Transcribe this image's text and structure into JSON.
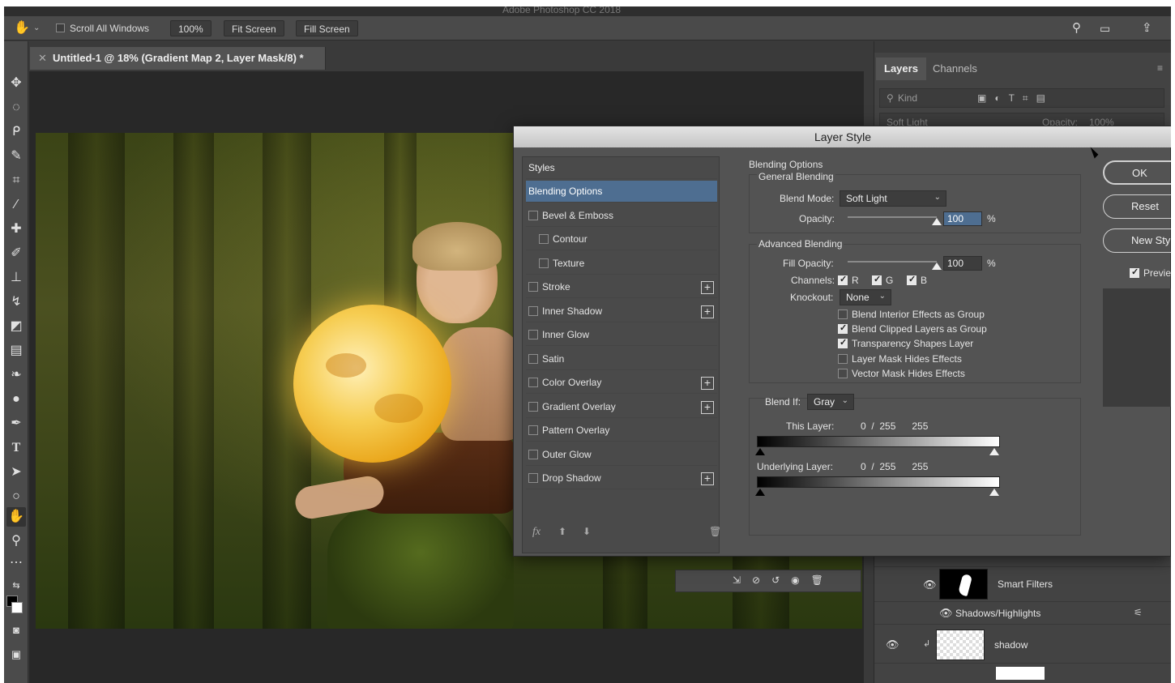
{
  "app": {
    "title_partial": "Adobe Photoshop CC 2018"
  },
  "options_bar": {
    "scroll_all_windows": "Scroll All Windows",
    "zoom": "100%",
    "fit_screen": "Fit Screen",
    "fill_screen": "Fill Screen"
  },
  "document_tab": {
    "title": "Untitled-1 @ 18% (Gradient Map 2, Layer Mask/8) *"
  },
  "layers_panel": {
    "tabs": [
      "Layers",
      "Channels"
    ],
    "filter_placeholder": "Kind",
    "blend_mode": "Soft Light",
    "opacity_label": "Opacity:",
    "opacity_value": "100%",
    "partial_label": "Smart Filters",
    "layers": [
      {
        "name": "Smart Filters",
        "visible": true
      },
      {
        "name": "Shadows/Highlights",
        "visible": true
      },
      {
        "name": "shadow",
        "visible": true
      }
    ]
  },
  "dialog": {
    "title": "Layer Style",
    "styles_header": "Styles",
    "styles": [
      {
        "label": "Blending Options",
        "selected": true,
        "checkbox": false,
        "plus": false,
        "indent": false
      },
      {
        "label": "Bevel & Emboss",
        "checkbox": true,
        "plus": false,
        "indent": false
      },
      {
        "label": "Contour",
        "checkbox": true,
        "plus": false,
        "indent": true
      },
      {
        "label": "Texture",
        "checkbox": true,
        "plus": false,
        "indent": true
      },
      {
        "label": "Stroke",
        "checkbox": true,
        "plus": true,
        "indent": false
      },
      {
        "label": "Inner Shadow",
        "checkbox": true,
        "plus": true,
        "indent": false
      },
      {
        "label": "Inner Glow",
        "checkbox": true,
        "plus": false,
        "indent": false
      },
      {
        "label": "Satin",
        "checkbox": true,
        "plus": false,
        "indent": false
      },
      {
        "label": "Color Overlay",
        "checkbox": true,
        "plus": true,
        "indent": false
      },
      {
        "label": "Gradient Overlay",
        "checkbox": true,
        "plus": true,
        "indent": false
      },
      {
        "label": "Pattern Overlay",
        "checkbox": true,
        "plus": false,
        "indent": false
      },
      {
        "label": "Outer Glow",
        "checkbox": true,
        "plus": false,
        "indent": false
      },
      {
        "label": "Drop Shadow",
        "checkbox": true,
        "plus": true,
        "indent": false
      }
    ],
    "footer_fx": "fx",
    "blending_options": {
      "heading": "Blending Options",
      "general": "General Blending",
      "blend_mode_label": "Blend Mode:",
      "blend_mode_value": "Soft Light",
      "opacity_label": "Opacity:",
      "opacity_value": "100",
      "pct": "%",
      "opacity_level": 1.0,
      "advanced": "Advanced Blending",
      "fill_opacity_label": "Fill Opacity:",
      "fill_opacity_value": "100",
      "fill_opacity_level": 1.0,
      "channels_label": "Channels:",
      "channels": [
        "R",
        "G",
        "B"
      ],
      "knockout_label": "Knockout:",
      "knockout_value": "None",
      "options": [
        {
          "label": "Blend Interior Effects as Group",
          "checked": false
        },
        {
          "label": "Blend Clipped Layers as Group",
          "checked": true
        },
        {
          "label": "Transparency Shapes Layer",
          "checked": true
        },
        {
          "label": "Layer Mask Hides Effects",
          "checked": false
        },
        {
          "label": "Vector Mask Hides Effects",
          "checked": false
        }
      ],
      "blend_if_label": "Blend If:",
      "blend_if_value": "Gray",
      "this_layer_label": "This Layer:",
      "this_layer_values": "0  /  255      255",
      "underlying_label": "Underlying Layer:",
      "underlying_values": "0  /  255      255"
    },
    "buttons": {
      "ok": "OK",
      "reset": "Reset",
      "new_style": "New Style...",
      "preview": "Preview"
    }
  }
}
